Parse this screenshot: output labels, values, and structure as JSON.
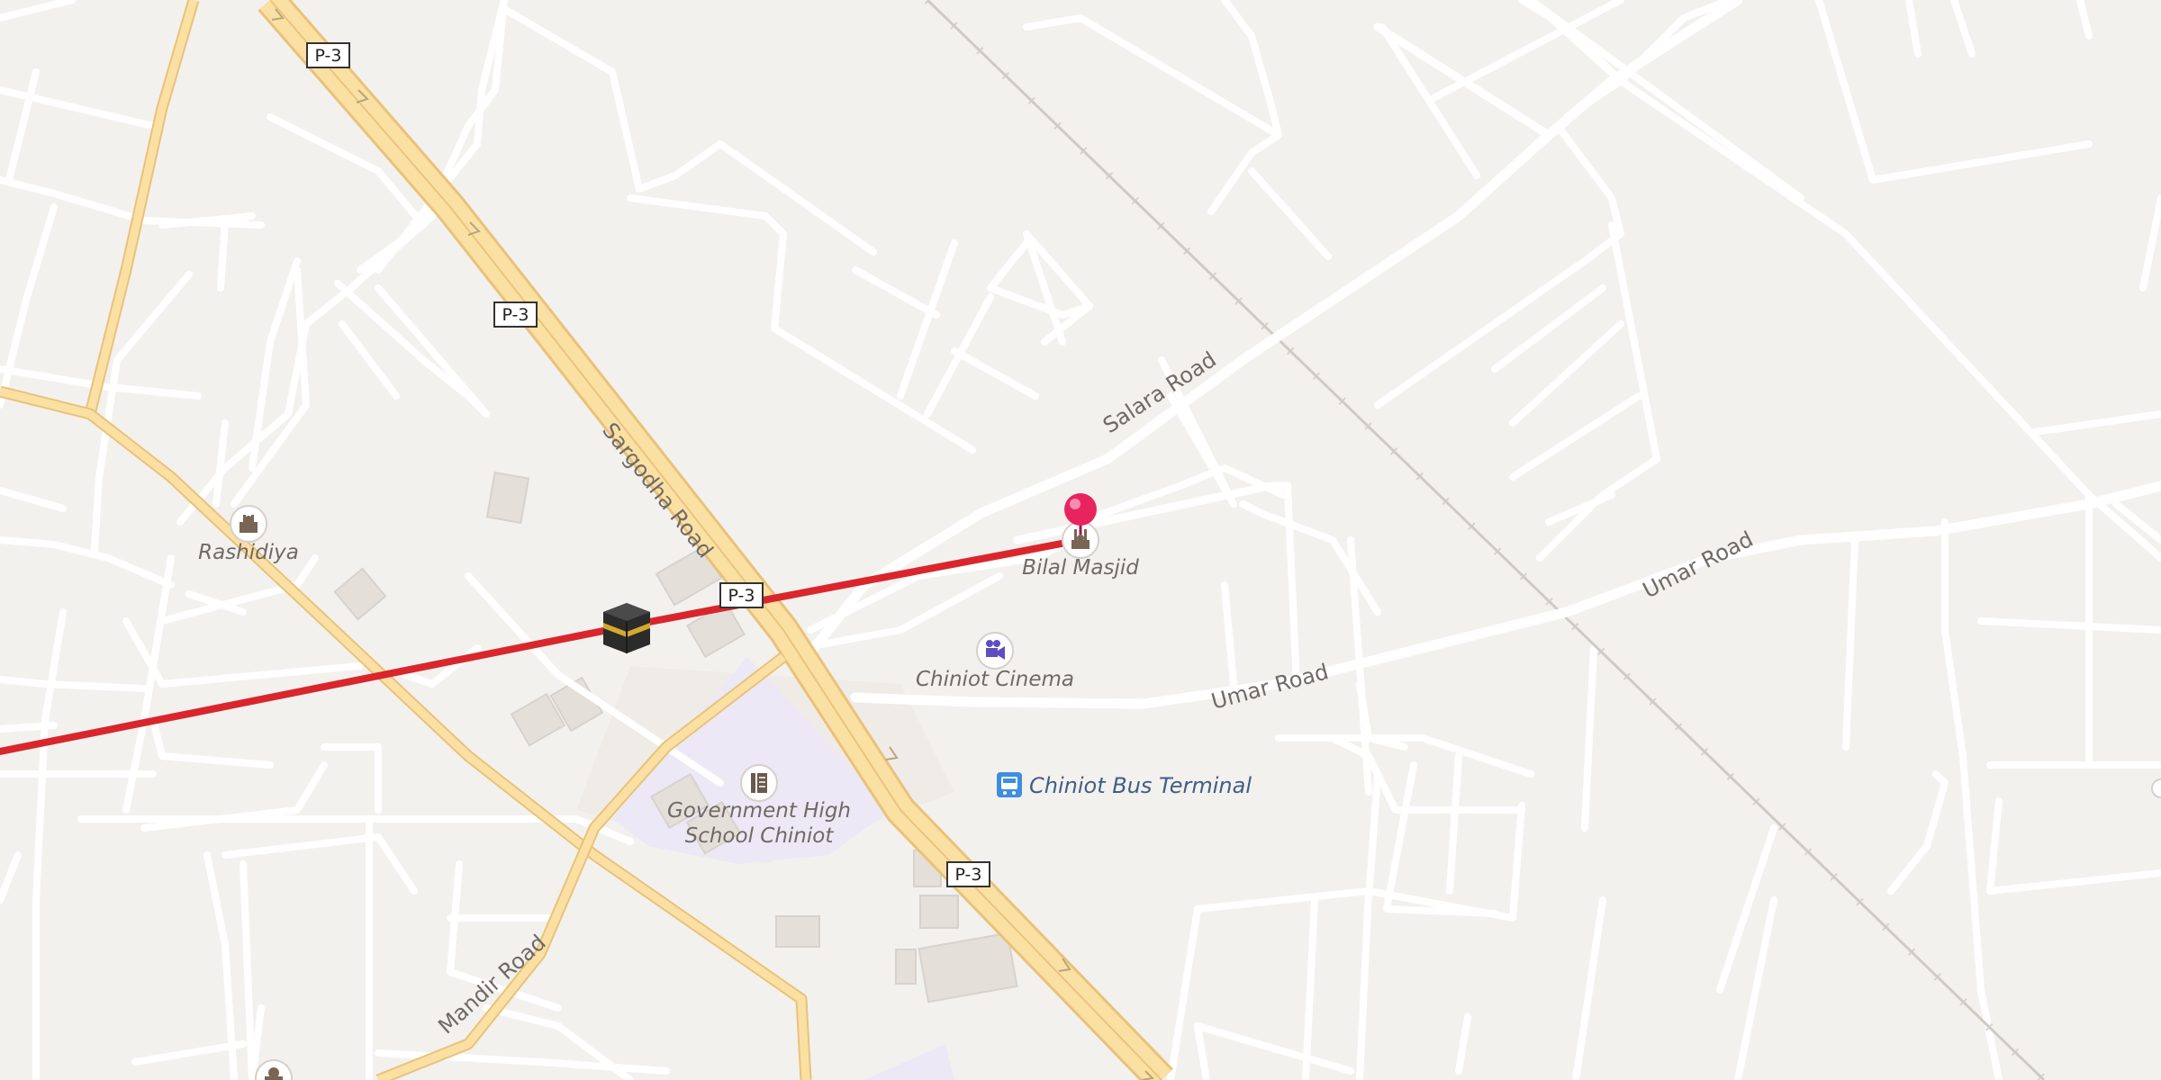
{
  "map": {
    "route_color": "#d9262c",
    "pin_color": "#e8245f",
    "roads": {
      "sargodha": "Sargodha Road",
      "salara": "Salara Road",
      "umar_1": "Umar Road",
      "umar_2": "Umar Road",
      "mandir": "Mandir Road"
    },
    "shields": [
      "P-3",
      "P-3",
      "P-3",
      "P-3"
    ],
    "pois": {
      "rashidiya": "Rashidiya",
      "bilal_masjid": "Bilal Masjid",
      "chiniot_cinema": "Chiniot Cinema",
      "bus_terminal": "Chiniot Bus Terminal",
      "school_line1": "Government High",
      "school_line2": "School Chiniot"
    },
    "icons": [
      "mosque-icon",
      "kaaba-icon",
      "cinema-icon",
      "bus-icon",
      "school-icon",
      "location-pin-icon"
    ]
  }
}
